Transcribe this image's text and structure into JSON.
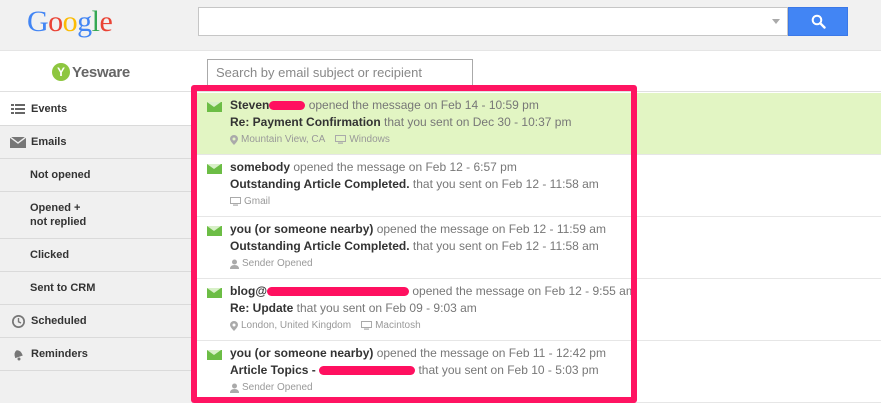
{
  "google": {
    "logo_letters": [
      {
        "char": "G",
        "color": "#4285f4"
      },
      {
        "char": "o",
        "color": "#ea4335"
      },
      {
        "char": "o",
        "color": "#fbbc05"
      },
      {
        "char": "g",
        "color": "#4285f4"
      },
      {
        "char": "l",
        "color": "#34a853"
      },
      {
        "char": "e",
        "color": "#ea4335"
      }
    ],
    "search_value": "",
    "search_button_color": "#4285f4"
  },
  "yesware": {
    "logo_mark": "Y",
    "logo_text": "Yesware",
    "search_placeholder": "Search by email subject or recipient"
  },
  "sidebar": {
    "items": [
      {
        "label": "Events",
        "icon": "list-icon",
        "active": true
      },
      {
        "label": "Emails",
        "icon": "envelope-icon"
      },
      {
        "label": "Not opened"
      },
      {
        "label": "Opened +\nnot replied"
      },
      {
        "label": "Clicked"
      },
      {
        "label": "Sent to CRM"
      },
      {
        "label": "Scheduled",
        "icon": "clock-icon"
      },
      {
        "label": "Reminders",
        "icon": "bell-icon"
      }
    ]
  },
  "events": [
    {
      "who": "Steven",
      "action": " opened the message on Feb 14 - 10:59 pm",
      "subject": "Re: Payment Confirmation",
      "sent": " that you sent on Dec 30 - 10:37 pm",
      "location": "Mountain View, CA",
      "device": "Windows"
    },
    {
      "who": "somebody",
      "action": " opened the message on Feb 12 - 6:57 pm",
      "subject": "Outstanding Article Completed.",
      "sent": " that you sent on Feb 12 - 11:58 am",
      "device": "Gmail"
    },
    {
      "who": "you (or someone nearby)",
      "action": " opened the message on Feb 12 - 11:59 am",
      "subject": "Outstanding Article Completed.",
      "sent": " that you sent on Feb 12 - 11:58 am",
      "person": "Sender Opened"
    },
    {
      "who": "blog@",
      "action": " opened the message on Feb 12 - 9:55 am",
      "subject": "Re: Update",
      "sent": " that you sent on Feb 09 - 9:03 am",
      "location": "London, United Kingdom",
      "device": "Macintosh"
    },
    {
      "who": "you (or someone nearby)",
      "action": " opened the message on Feb 11 - 12:42 pm",
      "subject": "Article Topics - ",
      "sent": " that you sent on Feb 10 - 5:03 pm",
      "person": "Sender Opened"
    }
  ],
  "colors": {
    "highlight_row": "#e2f5c3",
    "annotation_frame": "#ff1462",
    "envelope": "#6cbd45"
  }
}
